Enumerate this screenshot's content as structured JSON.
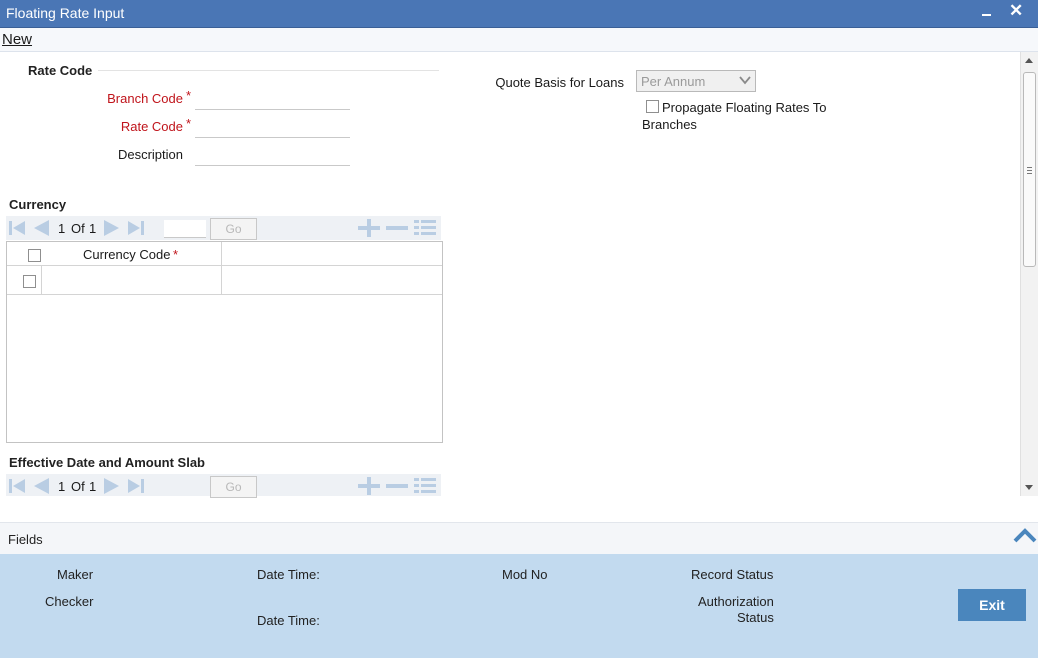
{
  "window": {
    "title": "Floating Rate Input",
    "close_glyph": "✕"
  },
  "menu": {
    "new_label": "New"
  },
  "rate_code_section": {
    "title": "Rate Code",
    "branch_code_label": "Branch Code",
    "rate_code_label": "Rate Code",
    "description_label": "Description",
    "required_mark": "*",
    "branch_code_value": "",
    "rate_code_value": "",
    "description_value": ""
  },
  "quote_basis": {
    "label": "Quote Basis for Loans",
    "selected": "Per Annum"
  },
  "propagate": {
    "label_line1": "Propagate Floating Rates To",
    "label_line2": "Branches",
    "checked": false
  },
  "currency_section": {
    "title": "Currency",
    "page_current": "1",
    "page_of": "Of",
    "page_total": "1",
    "go_label": "Go",
    "column_currency_code": "Currency Code",
    "required_mark": "*"
  },
  "effective_date_section": {
    "title": "Effective Date and Amount Slab",
    "page_current": "1",
    "page_of": "Of",
    "page_total": "1",
    "go_label": "Go"
  },
  "fields_bar": {
    "label": "Fields"
  },
  "footer": {
    "maker_label": "Maker",
    "checker_label": "Checker",
    "date_time_label_1": "Date Time:",
    "date_time_label_2": "Date Time:",
    "mod_no_label": "Mod No",
    "record_status_label": "Record Status",
    "authorization_line1": "Authorization",
    "authorization_line2": "Status",
    "exit_label": "Exit"
  },
  "colors": {
    "titlebar": "#4a76b5",
    "required": "#c0141b",
    "footer": "#c2daef",
    "exit_button": "#4a86bd",
    "nav_icon": "#b9cde3"
  },
  "icons": [
    "first-page-icon",
    "prev-page-icon",
    "next-page-icon",
    "last-page-icon",
    "add-row-icon",
    "delete-row-icon",
    "view-rows-icon",
    "chevron-up-icon",
    "close-icon",
    "minimize-icon",
    "dropdown-caret-icon"
  ]
}
